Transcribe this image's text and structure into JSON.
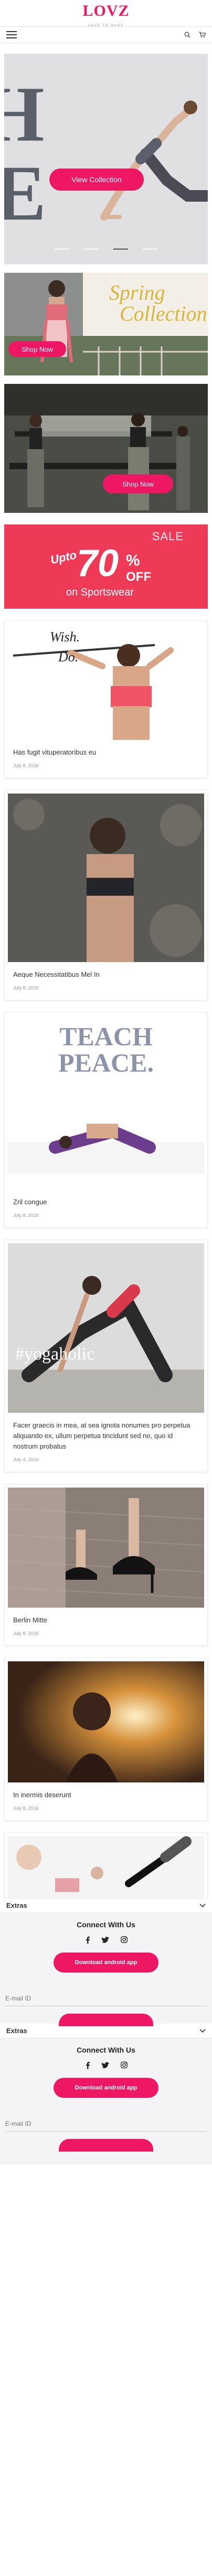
{
  "header": {
    "logo_text": "LOVZ",
    "logo_tagline": "LOVE TO SHOP"
  },
  "hero": {
    "button_label": "View Collection",
    "dots": [
      false,
      false,
      true,
      false
    ]
  },
  "banners": {
    "spring": {
      "script_line1": "Spring",
      "script_line2": "Collection",
      "button_label": "Shop Now"
    },
    "gym": {
      "button_label": "Shop Now"
    },
    "sale": {
      "word": "SALE",
      "upto": "Upto",
      "percent": "70",
      "percent_sign": "%",
      "off": "OFF",
      "subtitle": "on Sportswear"
    }
  },
  "posts": [
    {
      "title": "Has fugit vituperatoribus eu",
      "date": "July 8, 2016",
      "overlay_line1": "Wish.",
      "overlay_line2": "Do."
    },
    {
      "title": "Aeque Necessitatibus Mel In",
      "date": "July 8, 2016"
    },
    {
      "title": "Zril congue",
      "date": "July 8, 2016",
      "overlay_line1": "TEACH",
      "overlay_line2": "PEACE."
    },
    {
      "title": "Facer graecis in mea, at sea ignota nonumes pro perpetua aliquando ex, ullum perpetua tincidunt sed no, quo id nostrum probatus",
      "date": "July 4, 2016",
      "overlay_tag": "#yogaholic"
    },
    {
      "title": "Berlin Mitte",
      "date": "July 8, 2016"
    },
    {
      "title": "In inermis deserunt",
      "date": "July 8, 2016"
    }
  ],
  "footer": [
    {
      "accordion_label": "Extras",
      "connect_heading": "Connect With Us",
      "download_label": "Download android app",
      "email_placeholder": "E-mail ID"
    },
    {
      "accordion_label": "Extras",
      "connect_heading": "Connect With Us",
      "download_label": "Download android app",
      "email_placeholder": "E-mail ID"
    }
  ],
  "colors": {
    "brand": "#ee1764",
    "sale_bg": "#ef3a57",
    "footer_bg": "#f4f4f6"
  },
  "icons": [
    "menu-icon",
    "search-icon",
    "cart-icon",
    "facebook-icon",
    "twitter-icon",
    "instagram-icon",
    "chevron-down-icon"
  ]
}
